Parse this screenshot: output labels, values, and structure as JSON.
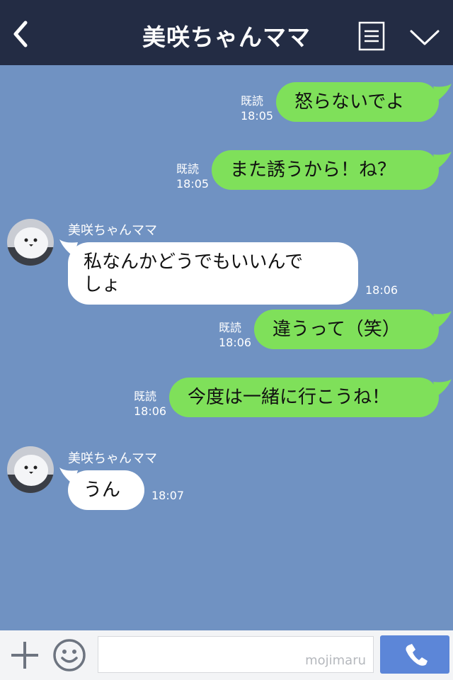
{
  "header": {
    "title": "美咲ちゃんママ"
  },
  "messages": [
    {
      "side": "out",
      "text": "怒らないでよ",
      "read": "既読",
      "time": "18:05"
    },
    {
      "side": "out",
      "text": "また誘うから！ね？",
      "read": "既読",
      "time": "18:05"
    },
    {
      "side": "in",
      "sender": "美咲ちゃんママ",
      "text": "私なんかどうでもいいんで",
      "text2": "しょ",
      "time": "18:06"
    },
    {
      "side": "out",
      "text": "違うって（笑）",
      "read": "既読",
      "time": "18:06"
    },
    {
      "side": "out",
      "text": "今度は一緒に行こうね！",
      "read": "既読",
      "time": "18:06"
    },
    {
      "side": "in",
      "sender": "美咲ちゃんママ",
      "text": "うん",
      "time": "18:07"
    }
  ],
  "footer": {
    "watermark": "mojimaru"
  },
  "colors": {
    "header_bg": "#232c44",
    "chat_bg": "#7092c2",
    "outgoing_bubble": "#7fe05a",
    "incoming_bubble": "#ffffff",
    "send_button": "#5c86d8"
  },
  "icons": [
    "back-arrow-icon",
    "menu-icon",
    "chevron-down-icon",
    "plus-icon",
    "smiley-icon",
    "phone-icon",
    "avatar-bird"
  ]
}
